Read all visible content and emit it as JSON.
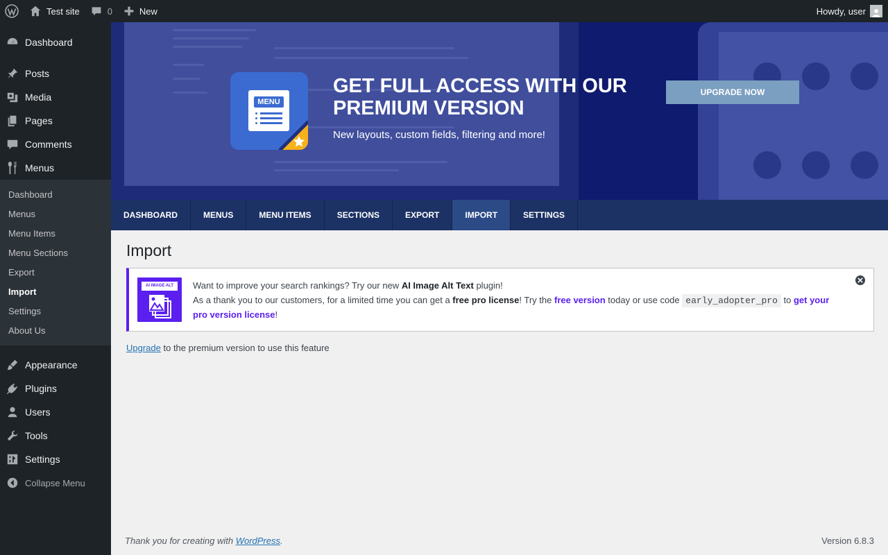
{
  "adminbar": {
    "site_name": "Test site",
    "comments_count": "0",
    "new_label": "New",
    "howdy": "Howdy, user"
  },
  "sidebar": {
    "top_items": [
      {
        "label": "Dashboard",
        "icon": "dashboard-icon"
      },
      {
        "label": "Posts",
        "icon": "pin-icon"
      },
      {
        "label": "Media",
        "icon": "media-icon"
      },
      {
        "label": "Pages",
        "icon": "pages-icon"
      },
      {
        "label": "Comments",
        "icon": "comment-icon"
      },
      {
        "label": "Menus",
        "icon": "fork-knife-icon"
      }
    ],
    "submenu": [
      "Dashboard",
      "Menus",
      "Menu Items",
      "Menu Sections",
      "Export",
      "Import",
      "Settings",
      "About Us"
    ],
    "bottom_items": [
      {
        "label": "Appearance",
        "icon": "brush-icon"
      },
      {
        "label": "Plugins",
        "icon": "plug-icon"
      },
      {
        "label": "Users",
        "icon": "user-icon"
      },
      {
        "label": "Tools",
        "icon": "wrench-icon"
      },
      {
        "label": "Settings",
        "icon": "sliders-icon"
      }
    ],
    "collapse_label": "Collapse Menu"
  },
  "banner": {
    "icon_tag": "MENU",
    "title": "GET FULL ACCESS WITH OUR PREMIUM VERSION",
    "subtitle": "New layouts, custom fields, filtering and more!",
    "button": "UPGRADE NOW"
  },
  "tabs": [
    "DASHBOARD",
    "MENUS",
    "MENU ITEMS",
    "SECTIONS",
    "EXPORT",
    "IMPORT",
    "SETTINGS"
  ],
  "page": {
    "title": "Import"
  },
  "notice": {
    "icon_label": "AI IMAGE ALT TEXT",
    "line1_pre": "Want to improve your search rankings? Try our new ",
    "line1_bold": "AI Image Alt Text",
    "line1_post": " plugin!",
    "line2_pre": "As a thank you to our customers, for a limited time you can get a ",
    "line2_bold": "free pro license",
    "line2_mid": "! Try the ",
    "line2_link1": "free version",
    "line2_mid2": " today or use code ",
    "code": "early_adopter_pro",
    "line2_mid3": " to ",
    "line2_link2": "get your pro version license",
    "line2_end": "!"
  },
  "upgrade_notice": {
    "link": "Upgrade",
    "text": " to the premium version to use this feature"
  },
  "footer": {
    "thanks_pre": "Thank you for creating with ",
    "thanks_link": "WordPress",
    "thanks_post": ".",
    "version": "Version 6.8.3"
  },
  "colors": {
    "adminbar": "#1d2327",
    "tabs_bg": "#1c3264",
    "tab_active": "#2c4a86",
    "notice_accent": "#5b1ff0",
    "upgrade_button": "#7b9fc1",
    "link": "#2271b1"
  }
}
